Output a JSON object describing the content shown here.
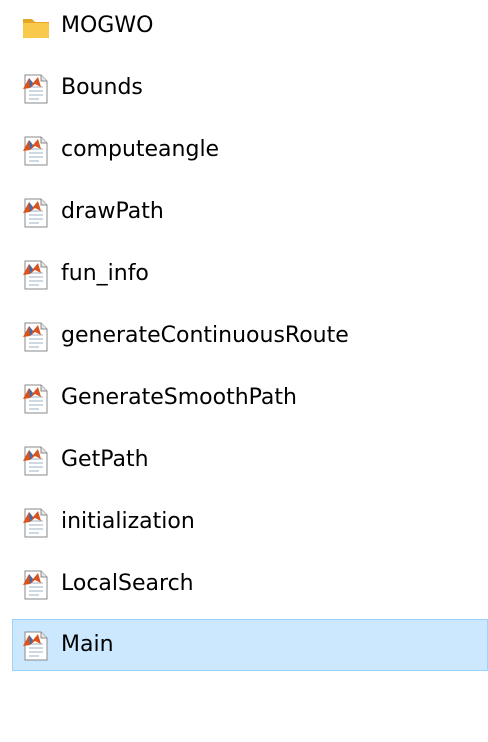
{
  "file_list": {
    "selected_index": 11,
    "items": [
      {
        "name": "MOGWO",
        "icon": "folder-icon",
        "type": "folder"
      },
      {
        "name": "Bounds",
        "icon": "matlab-file-icon",
        "type": "m-file"
      },
      {
        "name": "computeangle",
        "icon": "matlab-file-icon",
        "type": "m-file"
      },
      {
        "name": "drawPath",
        "icon": "matlab-file-icon",
        "type": "m-file"
      },
      {
        "name": "fun_info",
        "icon": "matlab-file-icon",
        "type": "m-file"
      },
      {
        "name": "generateContinuousRoute",
        "icon": "matlab-file-icon",
        "type": "m-file"
      },
      {
        "name": "GenerateSmoothPath",
        "icon": "matlab-file-icon",
        "type": "m-file"
      },
      {
        "name": "GetPath",
        "icon": "matlab-file-icon",
        "type": "m-file"
      },
      {
        "name": "initialization",
        "icon": "matlab-file-icon",
        "type": "m-file"
      },
      {
        "name": "LocalSearch",
        "icon": "matlab-file-icon",
        "type": "m-file"
      },
      {
        "name": "Main",
        "icon": "matlab-file-icon",
        "type": "m-file"
      }
    ]
  },
  "colors": {
    "selection_background": "#cce8ff",
    "selection_border": "#99d1ff",
    "folder": "#f8c94a",
    "matlab_icon_accent": "#d9531e"
  }
}
